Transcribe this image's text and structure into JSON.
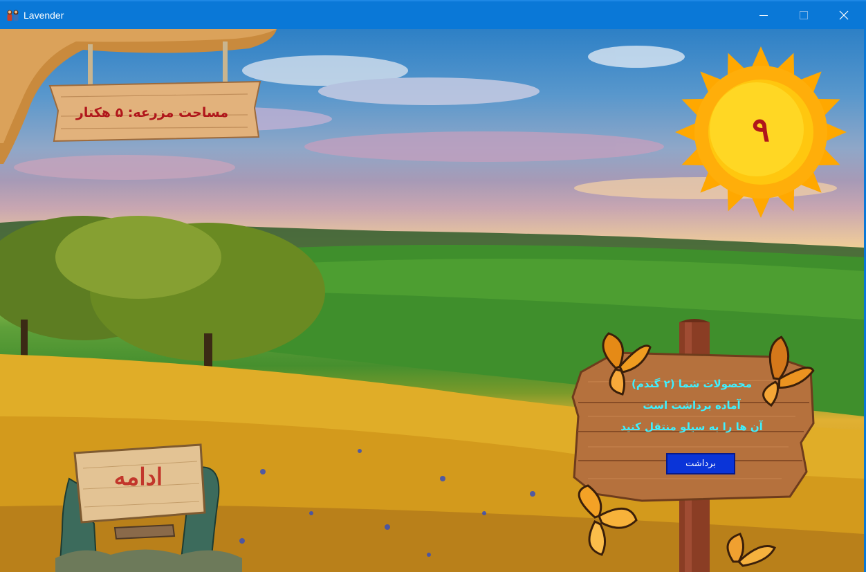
{
  "window": {
    "title": "Lavender",
    "controls": [
      "minimize-icon",
      "maximize-icon",
      "close-icon"
    ]
  },
  "farm_area": {
    "label": "مساحت مزرعه: ۵ هکتار"
  },
  "day_counter": {
    "value": "۹"
  },
  "crop_notice": {
    "line1": "محصولات شما (۲ گندم)",
    "line2": "آماده برداشت است",
    "line3": "آن ها را به سیلو منتقل کنید",
    "button_label": "برداشت"
  },
  "continue_sign": {
    "label": "ادامه"
  },
  "colors": {
    "titlebar": "#0a78d7",
    "sign_text_red": "#b0161b",
    "notice_text_cyan": "#3ff0ff",
    "button_blue": "#0a34d8",
    "sun_orange": "#ffa800",
    "sun_yellow": "#ffd724"
  }
}
